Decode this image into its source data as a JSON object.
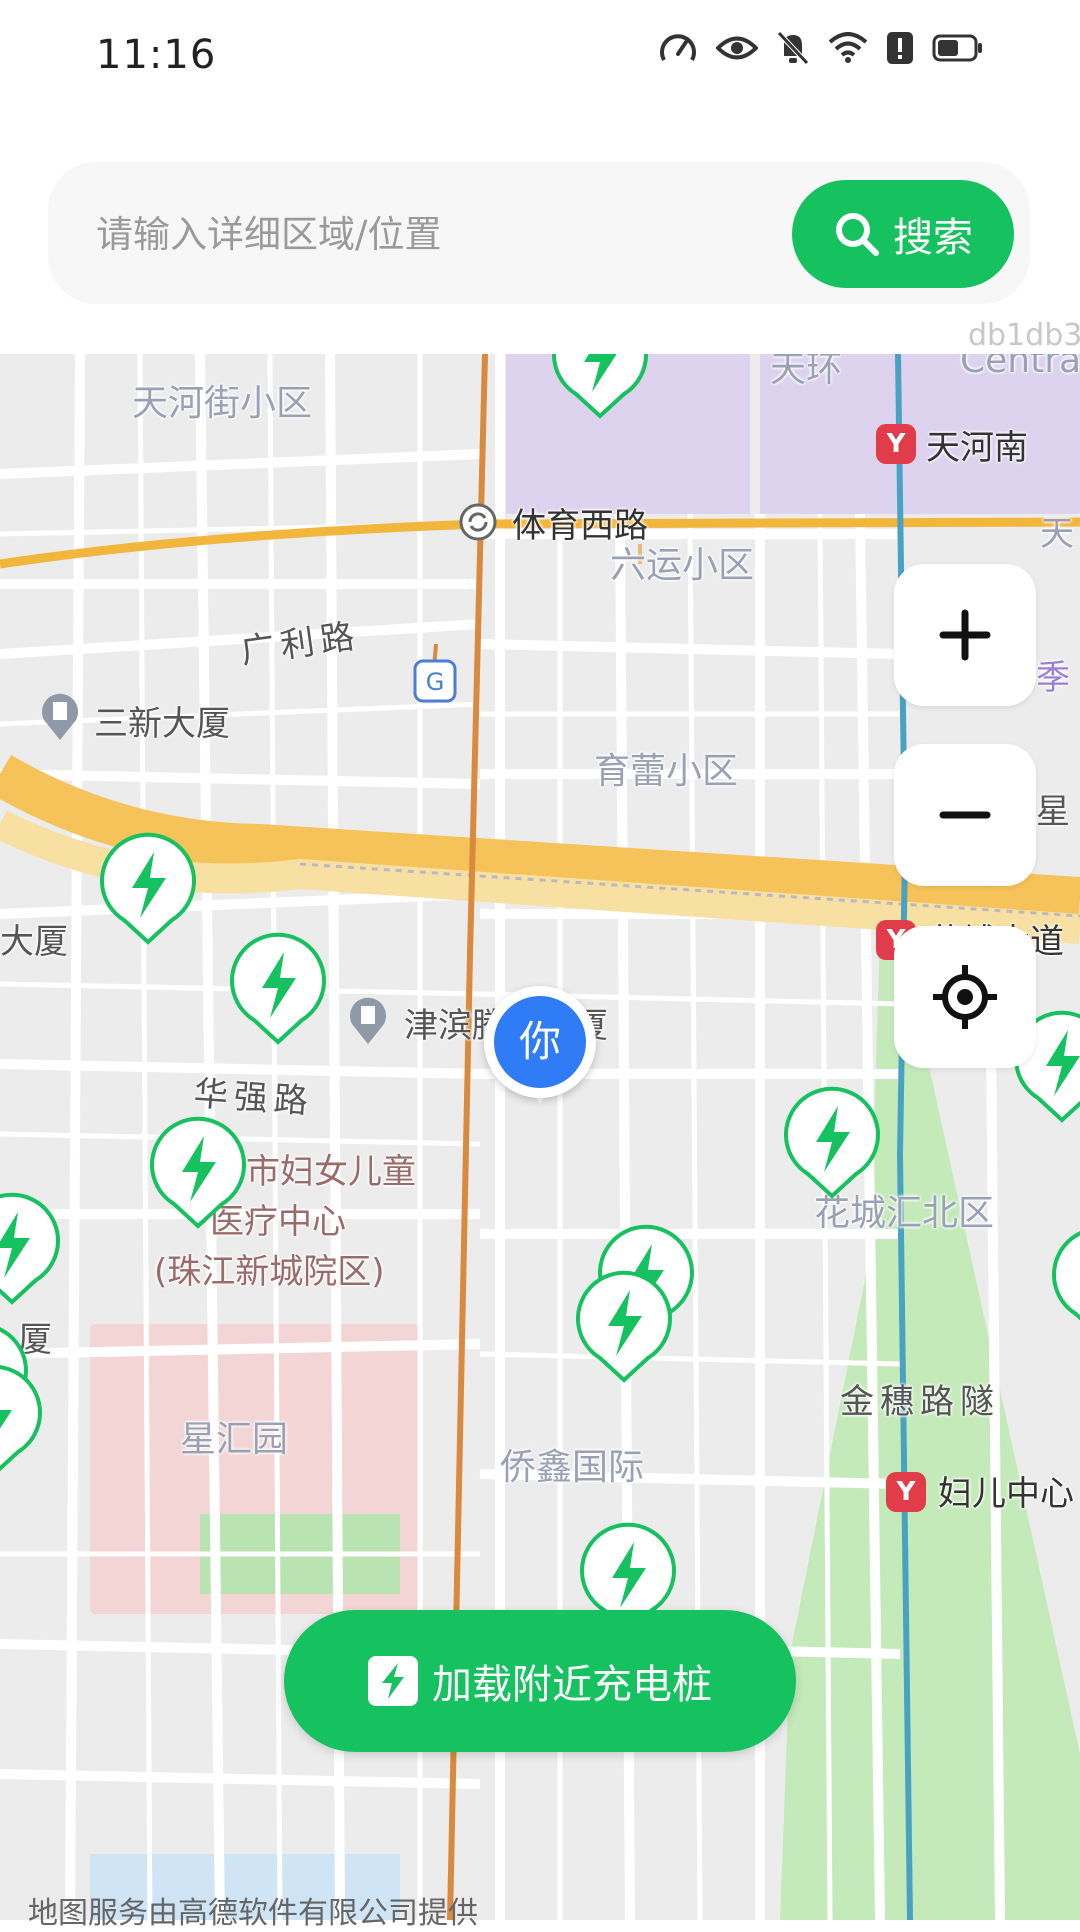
{
  "status_bar": {
    "time": "11:16",
    "icons": [
      "speed-icon",
      "eye-icon",
      "bell-muted-icon",
      "wifi-icon",
      "alert-icon",
      "battery-icon"
    ]
  },
  "search": {
    "placeholder": "请输入详细区域/位置",
    "button_label": "搜索",
    "debug_text": "db1db3"
  },
  "map": {
    "labels": {
      "tianhejie": "天河街小区",
      "tianhenan": "天河南",
      "tiyuxilu": "体育西路",
      "guanglilu": "广利路",
      "liuyun": "六运小区",
      "sanxin": "三新大厦",
      "yulei": "育蕾小区",
      "xing": "星",
      "ji": "季",
      "dasha_left": "大厦",
      "huangpu": "黄埔大道",
      "jinbin": "津滨腾越大厦",
      "huaqianglu": "华强路",
      "hospital_1": "市妇女儿童",
      "hospital_2": "医疗中心",
      "hospital_3": "(珠江新城院区)",
      "huacheng": "花城汇北区",
      "sha": "厦",
      "jinsuilu": "金穗路隧",
      "xinghuiyuan": "星汇园",
      "qiaoxin": "侨鑫国际",
      "fuerzhongxin": "妇儿中心",
      "tianhenan_top": "天环",
      "central": "Centra",
      "tian_right": "天"
    },
    "user_marker": "你",
    "copyright": "地图服务由高德软件有限公司提供"
  },
  "controls": {
    "zoom_in": "+",
    "zoom_out": "−"
  },
  "load_button": {
    "label": "加载附近充电桩"
  },
  "colors": {
    "accent": "#16c15f",
    "user": "#2f7cf6",
    "metro": "#e03c4a"
  }
}
